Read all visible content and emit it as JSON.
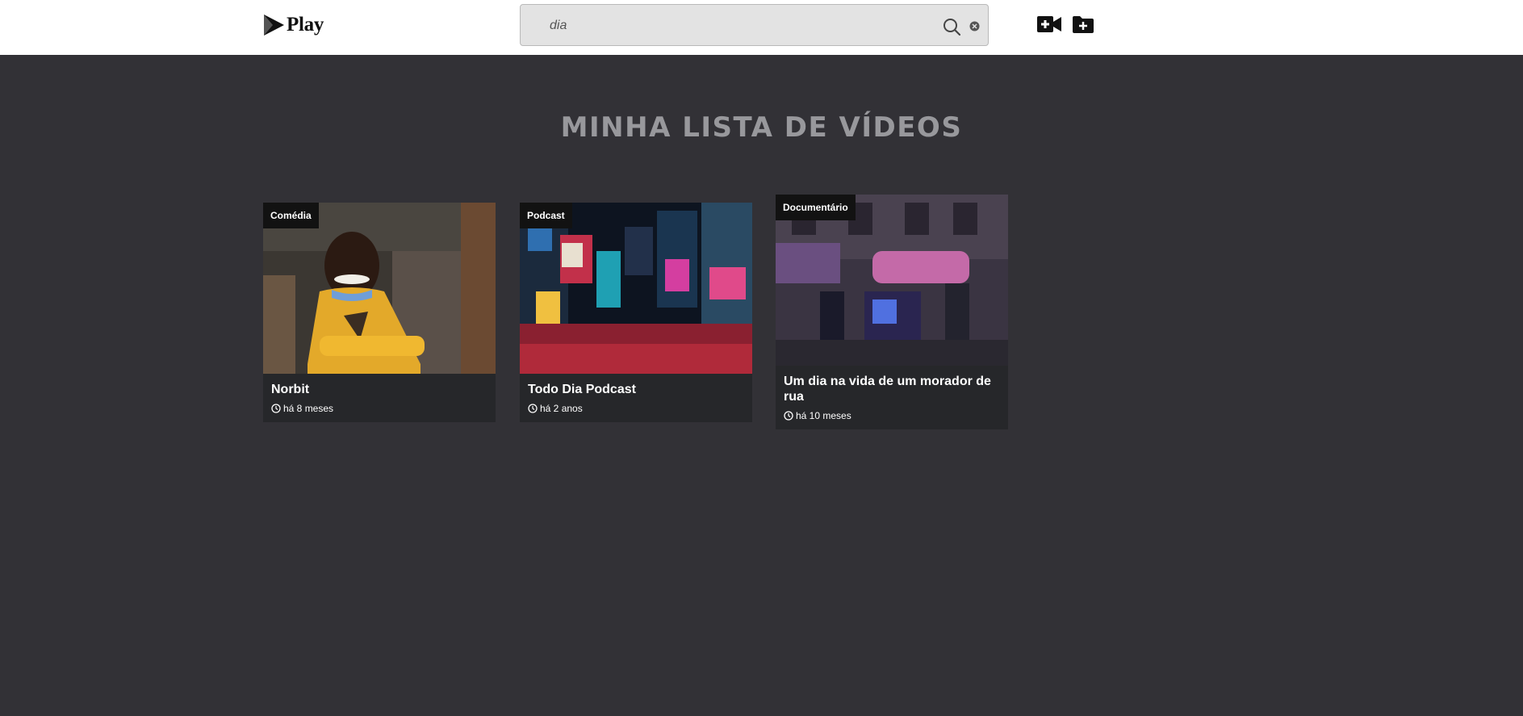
{
  "header": {
    "logo_text": "Play",
    "search": {
      "value": "dia",
      "placeholder": ""
    }
  },
  "main": {
    "title": "MINHA LISTA DE VÍDEOS",
    "videos": [
      {
        "category": "Comédia",
        "title": "Norbit",
        "age": "há 8 meses"
      },
      {
        "category": "Podcast",
        "title": "Todo Dia Podcast",
        "age": "há 2 anos"
      },
      {
        "category": "Documentário",
        "title": "Um dia na vida de um morador de rua",
        "age": "há 10 meses"
      }
    ]
  },
  "icons": {
    "logo": "play-triangle-icon",
    "search": "search-icon",
    "clear": "clear-icon",
    "add_video": "add-video-icon",
    "add_folder": "add-folder-icon",
    "time": "clock-icon"
  },
  "colors": {
    "background": "#323136",
    "header": "#ffffff",
    "card": "#26272a",
    "badge": "#121212",
    "title": "#98989c"
  }
}
